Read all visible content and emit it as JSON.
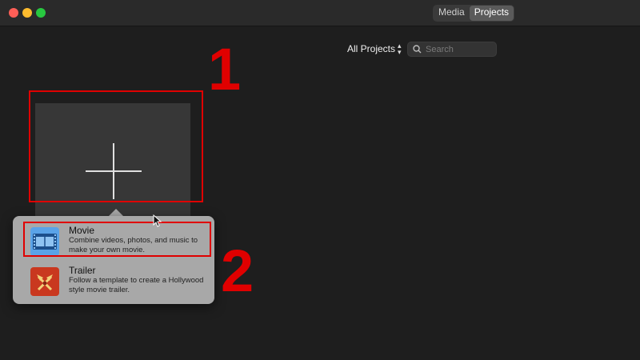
{
  "toolbar": {
    "tabs": [
      {
        "label": "Media"
      },
      {
        "label": "Projects"
      }
    ]
  },
  "filter": {
    "label": "All Projects"
  },
  "search": {
    "placeholder": "Search"
  },
  "annotations": {
    "step1": "1",
    "step2": "2"
  },
  "menu": {
    "options": [
      {
        "title": "Movie",
        "description": "Combine videos, photos, and music to make your own movie.",
        "icon": "film-strip-icon"
      },
      {
        "title": "Trailer",
        "description": "Follow a template to create a Hollywood style movie trailer.",
        "icon": "trailer-icon"
      }
    ]
  },
  "colors": {
    "annotation": "#e00000",
    "background": "#1e1e1e",
    "popover": "#a8a8a8"
  }
}
